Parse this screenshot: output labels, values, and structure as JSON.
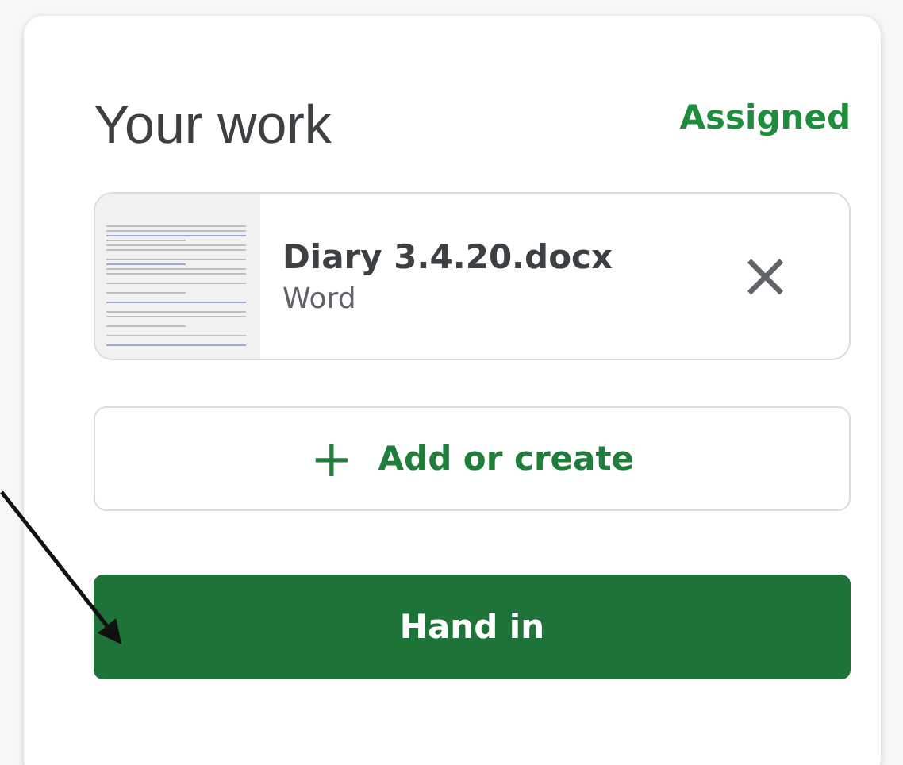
{
  "panel": {
    "title": "Your work",
    "status": "Assigned"
  },
  "attachments": [
    {
      "name": "Diary 3.4.20.docx",
      "type": "Word",
      "remove_icon": "×"
    }
  ],
  "add_button": {
    "icon": "+",
    "label": "Add or create"
  },
  "submit_button": {
    "label": "Hand in"
  }
}
